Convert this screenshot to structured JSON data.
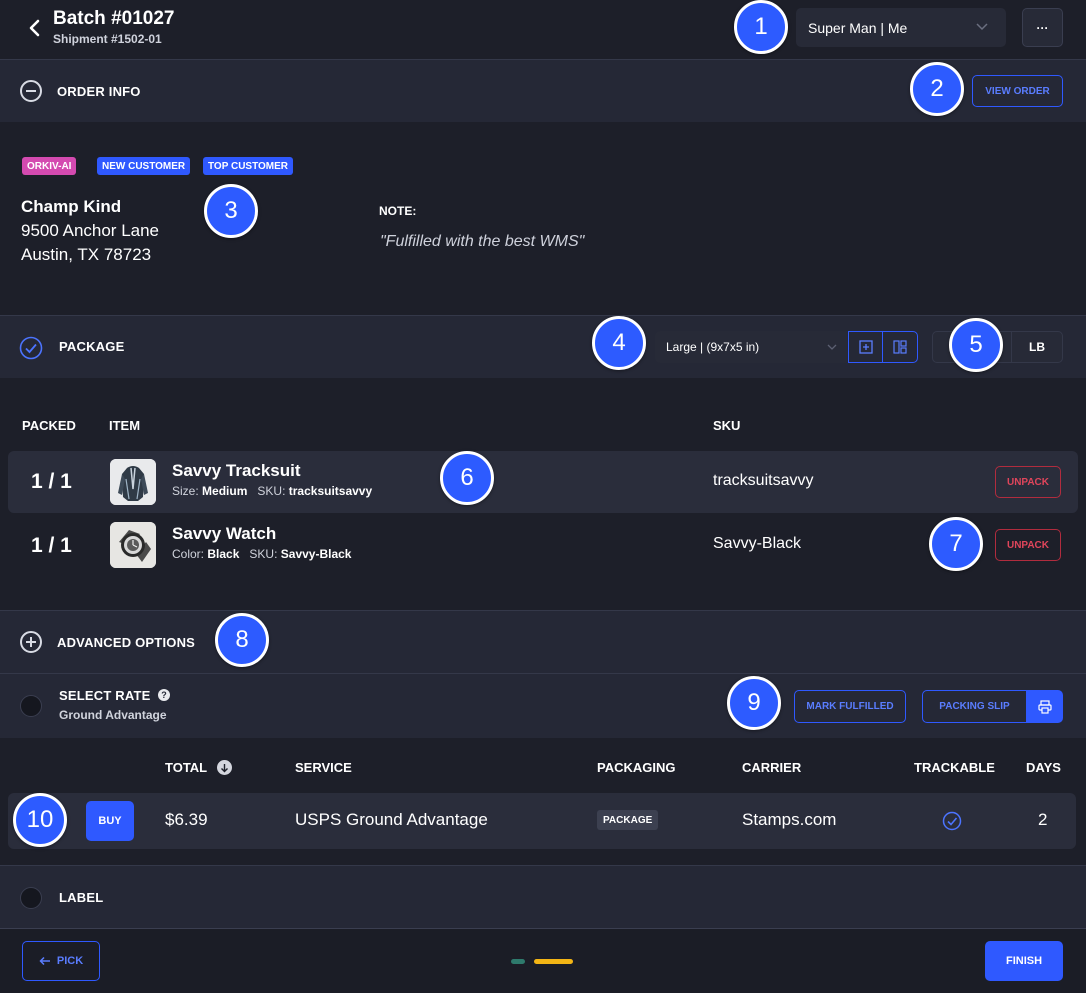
{
  "header": {
    "title": "Batch #01027",
    "subtitle": "Shipment #1502-01",
    "user_select": "Super Man | Me",
    "more_label": "···"
  },
  "order_info": {
    "section_label": "ORDER INFO",
    "view_order_label": "VIEW ORDER",
    "tags": [
      "ORKIV-AI",
      "NEW CUSTOMER",
      "TOP CUSTOMER"
    ],
    "customer_name": "Champ Kind",
    "address_line1": "9500 Anchor Lane",
    "address_line2": "Austin, TX 78723",
    "note_label": "NOTE:",
    "note_text": "\"Fulfilled with the best WMS\""
  },
  "package": {
    "section_label": "PACKAGE",
    "box_select": "Large | (9x7x5 in)",
    "unit_label": "LB",
    "columns": {
      "packed": "PACKED",
      "item": "ITEM",
      "sku": "SKU"
    },
    "items": [
      {
        "packed": "1 / 1",
        "name": "Savvy Tracksuit",
        "attr_label": "Size:",
        "attr_value": "Medium",
        "sku_label": "SKU:",
        "sku_inline": "tracksuitsavvy",
        "sku": "tracksuitsavvy",
        "action": "UNPACK"
      },
      {
        "packed": "1 / 1",
        "name": "Savvy Watch",
        "attr_label": "Color:",
        "attr_value": "Black",
        "sku_label": "SKU:",
        "sku_inline": "Savvy-Black",
        "sku": "Savvy-Black",
        "action": "UNPACK"
      }
    ]
  },
  "advanced": {
    "section_label": "ADVANCED OPTIONS"
  },
  "rate": {
    "section_label": "SELECT RATE",
    "help_icon": "?",
    "selected": "Ground Advantage",
    "mark_fulfilled_label": "MARK FULFILLED",
    "packing_slip_label": "PACKING SLIP",
    "columns": {
      "total": "TOTAL",
      "service": "SERVICE",
      "packaging": "PACKAGING",
      "carrier": "CARRIER",
      "trackable": "TRACKABLE",
      "days": "DAYS"
    },
    "rows": [
      {
        "buy_label": "BUY",
        "total": "$6.39",
        "service": "USPS Ground Advantage",
        "packaging": "PACKAGE",
        "carrier": "Stamps.com",
        "days": "2"
      }
    ]
  },
  "label": {
    "section_label": "LABEL"
  },
  "footer": {
    "pick_label": "PICK",
    "finish_label": "FINISH"
  },
  "callouts": [
    "1",
    "2",
    "3",
    "4",
    "5",
    "6",
    "7",
    "8",
    "9",
    "10"
  ],
  "colors": {
    "accent": "#2f59ff",
    "danger": "#e0455b",
    "tag_pink": "#d44ab0",
    "tag_blue": "#2f59ff",
    "progress_done": "#2e7a6c",
    "progress_active": "#f3b515"
  },
  "icons": [
    "back-chevron-icon",
    "chevron-down-icon",
    "more-icon",
    "collapse-minus-icon",
    "check-circle-icon",
    "add-box-icon",
    "layout-icon",
    "plus-circle-icon",
    "help-icon",
    "printer-icon",
    "sort-down-icon",
    "trackable-check-icon",
    "arrow-left-icon"
  ]
}
